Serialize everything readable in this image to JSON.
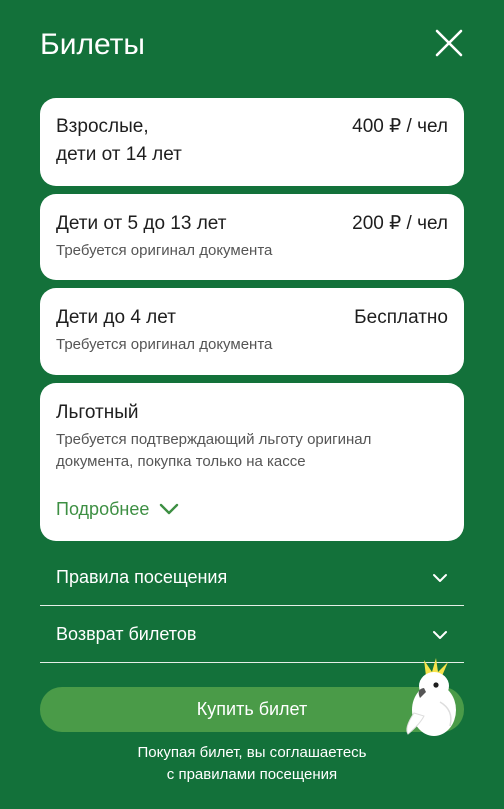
{
  "header": {
    "title": "Билеты",
    "close_icon": "close-icon"
  },
  "tickets": [
    {
      "name_line1": "Взрослые,",
      "name_line2": "дети от 14 лет",
      "price": "400 ₽ / чел"
    },
    {
      "name": "Дети от 5 до 13 лет",
      "price": "200 ₽ / чел",
      "note": "Требуется оригинал документа"
    },
    {
      "name": "Дети до 4 лет",
      "price": "Бесплатно",
      "note": "Требуется оригинал документа"
    },
    {
      "name": "Льготный",
      "note_line1": "Требуется подтверждающий льготу оригинал",
      "note_line2": "документа, покупка только на кассе",
      "more_label": "Подробнее"
    }
  ],
  "accordions": [
    {
      "label": "Правила посещения"
    },
    {
      "label": "Возврат билетов"
    }
  ],
  "buy_label": "Купить билет",
  "footnote_line1": "Покупая билет, вы соглашаетесь",
  "footnote_line2": "с правилами посещения",
  "colors": {
    "background": "#13713a",
    "button": "#4a9b48",
    "link": "#3d8f43"
  }
}
